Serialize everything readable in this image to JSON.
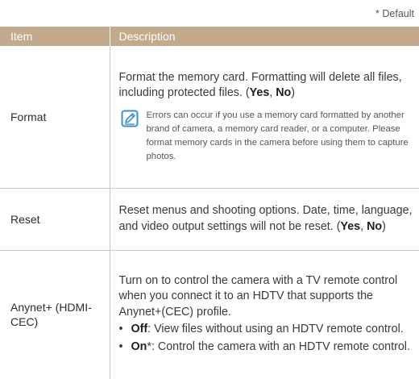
{
  "default_note": "* Default",
  "table": {
    "headers": {
      "item": "Item",
      "description": "Description"
    },
    "format": {
      "item": "Format",
      "desc_text": "Format the memory card. Formatting will delete all files, including protected files. (",
      "opt1": "Yes",
      "sep": ", ",
      "opt2": "No",
      "close": ")",
      "note_icon": "note-pencil-icon",
      "note": "Errors can occur if you use a memory card formatted by another brand of camera, a memory card reader, or a computer. Please format memory cards in the camera before using them to capture photos."
    },
    "reset": {
      "item": "Reset",
      "desc_text": "Reset menus and shooting options. Date, time, language, and video output settings will not be reset. (",
      "opt1": "Yes",
      "sep": ", ",
      "opt2": "No",
      "close": ")"
    },
    "anynet": {
      "item": "Anynet+ (HDMI-CEC)",
      "desc_text": "Turn on to control the camera with a TV remote control when you connect it to an HDTV that supports the Anynet+(CEC) profile.",
      "options": [
        {
          "name": "Off",
          "suffix": "",
          "text": ": View files without using an HDTV remote control."
        },
        {
          "name": "On",
          "suffix": "*",
          "text": ": Control the camera with an HDTV remote control."
        }
      ]
    }
  },
  "colors": {
    "header_bg": "#c3a98c",
    "accent_icon": "#3a8fd0"
  }
}
